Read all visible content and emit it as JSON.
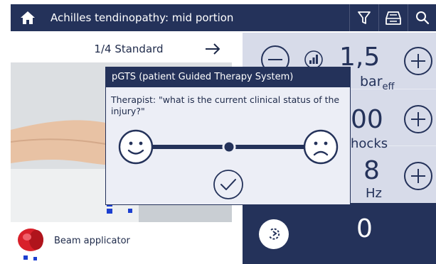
{
  "header": {
    "title": "Achilles tendinopathy: mid portion",
    "home_icon": "home-icon",
    "filter_icon": "filter-icon",
    "device_icon": "device-icon",
    "search_icon": "search-icon"
  },
  "left": {
    "standard_label": "1/4 Standard",
    "next_icon": "arrow-right-icon",
    "applicator_label": "Beam applicator"
  },
  "params": {
    "pressure_value": "1,5",
    "pressure_unit": "bar",
    "pressure_unit_sub": "eff",
    "shocks_value": "00",
    "shocks_unit": "hocks",
    "frequency_value": "8",
    "frequency_unit": "Hz",
    "counter_value": "0"
  },
  "dialog": {
    "title": "pGTS (patient Guided Therapy System)",
    "question": "Therapist: \"what is the current clinical status of the injury?\"",
    "slider_value": 0.5
  },
  "colors": {
    "navy": "#24325a",
    "panel": "#d7dbe9",
    "dialog_bg": "#eceef6",
    "accent_blue": "#1c3fd0",
    "applicator_red": "#d8202a"
  }
}
